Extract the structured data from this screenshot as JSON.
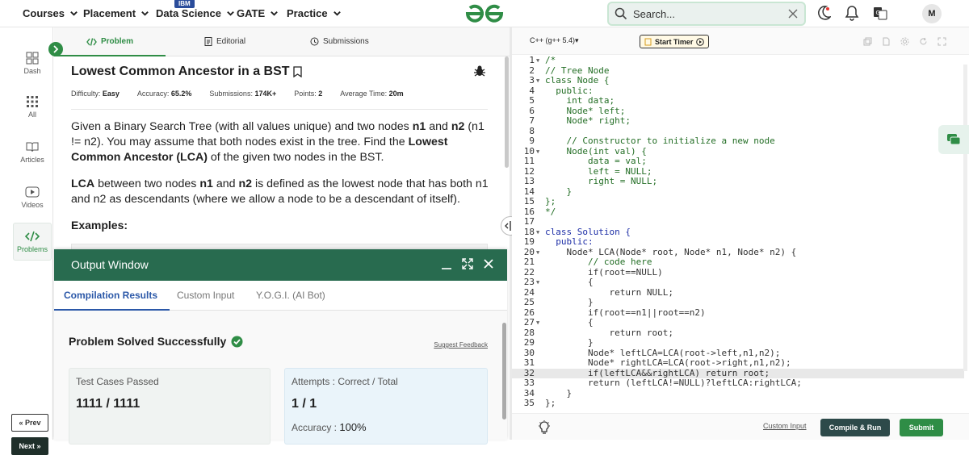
{
  "nav": {
    "items": [
      "Courses",
      "Placement",
      "Data Science",
      "GATE",
      "Practice"
    ],
    "ibm_badge": "IBM"
  },
  "search": {
    "placeholder": "Search..."
  },
  "user": {
    "avatar": "M"
  },
  "sidebar": {
    "items": [
      "Dash",
      "All",
      "Articles",
      "Videos",
      "Problems"
    ],
    "prev": "« Prev",
    "next": "Next »"
  },
  "tabs": {
    "problem": "Problem",
    "editorial": "Editorial",
    "submissions": "Submissions"
  },
  "problem": {
    "title": "Lowest Common Ancestor in a BST",
    "meta": [
      {
        "label": "Difficulty: ",
        "value": "Easy"
      },
      {
        "label": "Accuracy: ",
        "value": "65.2%"
      },
      {
        "label": "Submissions: ",
        "value": "174K+"
      },
      {
        "label": "Points: ",
        "value": "2"
      },
      {
        "label": "Average Time: ",
        "value": "20m"
      }
    ],
    "p1a": "Given a Binary Search Tree (with all values unique) and two nodes ",
    "p1b": "n1",
    "p1c": " and ",
    "p1d": "n2",
    "p1e": " (n1 != n2). You may assume that both nodes exist in the tree. Find the ",
    "p1f": "Lowest Common Ancestor (LCA)",
    "p1g": " of the given two nodes in the BST.",
    "p2a": "LCA",
    "p2b": " between two nodes ",
    "p2c": "n1",
    "p2d": " and ",
    "p2e": "n2",
    "p2f": " is defined as the lowest node that has both n1 and n2 as descendants (where we allow a node to be a descendant of itself).",
    "examples": "Examples:"
  },
  "output": {
    "title": "Output Window",
    "tabs": [
      "Compilation Results",
      "Custom Input",
      "Y.O.G.I. (AI Bot)"
    ],
    "solved": "Problem Solved Successfully",
    "suggest": "Suggest Feedback",
    "tests_label": "Test Cases Passed",
    "tests_value": "1111 / 1111",
    "attempts_label": "Attempts : Correct / Total",
    "attempts_value": "1 / 1",
    "accuracy_label": "Accuracy : ",
    "accuracy_value": "100%"
  },
  "editor": {
    "language": "C++ (g++ 5.4)",
    "timer": "Start Timer",
    "custom_input": "Custom Input",
    "compile": "Compile & Run",
    "submit": "Submit",
    "highlight_line": 32,
    "lines": [
      {
        "n": 1,
        "f": true,
        "t": "/*",
        "c": "cmt"
      },
      {
        "n": 2,
        "t": "// Tree Node",
        "c": "cmt"
      },
      {
        "n": 3,
        "f": true,
        "t": "class Node {",
        "c": "cmt"
      },
      {
        "n": 4,
        "t": "  public:",
        "c": "cmt"
      },
      {
        "n": 5,
        "t": "    int data;",
        "c": "cmt"
      },
      {
        "n": 6,
        "t": "    Node* left;",
        "c": "cmt"
      },
      {
        "n": 7,
        "t": "    Node* right;",
        "c": "cmt"
      },
      {
        "n": 8,
        "t": "",
        "c": "cmt"
      },
      {
        "n": 9,
        "t": "    // Constructor to initialize a new node",
        "c": "cmt"
      },
      {
        "n": 10,
        "f": true,
        "t": "    Node(int val) {",
        "c": "cmt"
      },
      {
        "n": 11,
        "t": "        data = val;",
        "c": "cmt"
      },
      {
        "n": 12,
        "t": "        left = NULL;",
        "c": "cmt"
      },
      {
        "n": 13,
        "t": "        right = NULL;",
        "c": "cmt"
      },
      {
        "n": 14,
        "t": "    }",
        "c": "cmt"
      },
      {
        "n": 15,
        "t": "};",
        "c": "cmt"
      },
      {
        "n": 16,
        "t": "*/",
        "c": "cmt"
      },
      {
        "n": 17,
        "t": ""
      },
      {
        "n": 18,
        "f": true,
        "t": "class Solution {",
        "c": "kw"
      },
      {
        "n": 19,
        "t": "  public:",
        "c": "kw"
      },
      {
        "n": 20,
        "f": true,
        "t": "    Node* LCA(Node* root, Node* n1, Node* n2) {"
      },
      {
        "n": 21,
        "t": "        // code here",
        "c": "cmt"
      },
      {
        "n": 22,
        "t": "        if(root==NULL)"
      },
      {
        "n": 23,
        "f": true,
        "t": "        {"
      },
      {
        "n": 24,
        "t": "            return NULL;"
      },
      {
        "n": 25,
        "t": "        }"
      },
      {
        "n": 26,
        "t": "        if(root==n1||root==n2)"
      },
      {
        "n": 27,
        "f": true,
        "t": "        {"
      },
      {
        "n": 28,
        "t": "            return root;"
      },
      {
        "n": 29,
        "t": "        }"
      },
      {
        "n": 30,
        "t": "        Node* leftLCA=LCA(root->left,n1,n2);"
      },
      {
        "n": 31,
        "t": "        Node* rightLCA=LCA(root->right,n1,n2);"
      },
      {
        "n": 32,
        "t": "        if(leftLCA&&rightLCA) return root;"
      },
      {
        "n": 33,
        "t": "        return (leftLCA!=NULL)?leftLCA:rightLCA;"
      },
      {
        "n": 34,
        "t": "    }"
      },
      {
        "n": 35,
        "t": "};"
      }
    ]
  },
  "colors": {
    "brand": "#2f8d46",
    "output_header": "#286b4f",
    "tab_blue": "#2b58a8"
  }
}
